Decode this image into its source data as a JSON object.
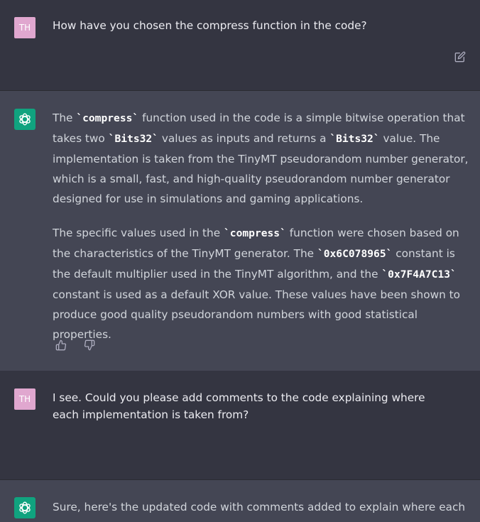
{
  "messages": [
    {
      "role": "user",
      "avatar_initials": "TH",
      "text": "How have you chosen the compress function in the code?"
    },
    {
      "role": "assistant",
      "paragraph1": {
        "t1": "The ",
        "c1": "`compress`",
        "t2": " function used in the code is a simple bitwise operation that takes two ",
        "c2": "`Bits32`",
        "t3": " values as inputs and returns a ",
        "c3": "`Bits32`",
        "t4": " value. The implementation is taken from the TinyMT pseudorandom number generator, which is a small, fast, and high-quality pseudorandom number generator designed for use in simulations and gaming applications."
      },
      "paragraph2": {
        "t1": "The specific values used in the ",
        "c1": "`compress`",
        "t2": " function were chosen based on the characteristics of the TinyMT generator. The ",
        "c2": "`0x6C078965`",
        "t3": " constant is the default multiplier used in the TinyMT algorithm, and the ",
        "c3": "`0x7F4A7C13`",
        "t4": " constant is used as a default XOR value. These values have been shown to produce good quality pseudorandom numbers with good statistical properties."
      }
    },
    {
      "role": "user",
      "avatar_initials": "TH",
      "text": "I see. Could you please add comments to the code explaining where each implementation is taken from?"
    },
    {
      "role": "assistant",
      "text": "Sure, here's the updated code with comments added to explain where each"
    }
  ],
  "icons": {
    "edit": "edit-icon",
    "thumbs_up": "thumbs-up-icon",
    "thumbs_down": "thumbs-down-icon",
    "assistant_logo": "openai-logo-icon"
  },
  "colors": {
    "user_bg": "#343541",
    "assistant_bg": "#444654",
    "avatar_user": "#e0a7cf",
    "avatar_assistant": "#10a37f"
  }
}
